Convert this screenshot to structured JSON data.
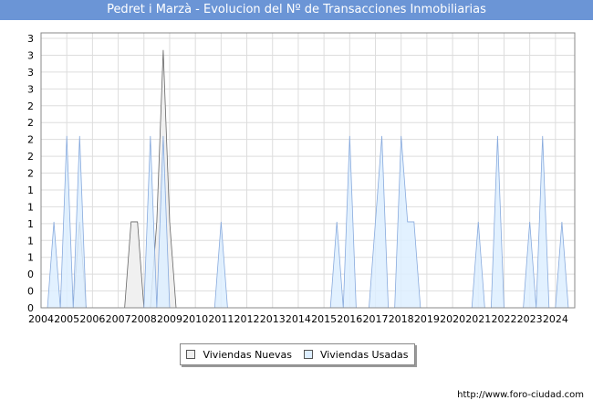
{
  "title": "Pedret i Marzà - Evolucion del Nº de Transacciones Inmobiliarias",
  "source": "http://www.foro-ciudad.com",
  "chart_data": {
    "type": "area",
    "x_ticks": [
      "2004",
      "2005",
      "2006",
      "2007",
      "2008",
      "2009",
      "2010",
      "2011",
      "2012",
      "2013",
      "2014",
      "2015",
      "2016",
      "2017",
      "2018",
      "2019",
      "2020",
      "2021",
      "2022",
      "2023",
      "2024"
    ],
    "y_tick_labels": [
      "0",
      "0",
      "0",
      "1",
      "1",
      "1",
      "1",
      "1",
      "2",
      "2",
      "2",
      "2",
      "2",
      "3",
      "3",
      "3",
      "3"
    ],
    "ylim": [
      0,
      3.2
    ],
    "xlim": [
      2004,
      2024.75
    ],
    "legend_position": "bottom-center",
    "grid": true,
    "series": [
      {
        "name": "Viviendas Nuevas",
        "color": "#f0f0f0",
        "stroke": "#666666",
        "points": [
          [
            2005.25,
            0
          ],
          [
            2005.5,
            1
          ],
          [
            2005.75,
            0
          ],
          [
            2007.25,
            0
          ],
          [
            2007.5,
            1
          ],
          [
            2007.75,
            1
          ],
          [
            2008,
            0
          ],
          [
            2008.25,
            0
          ],
          [
            2008.5,
            1
          ],
          [
            2008.75,
            3
          ],
          [
            2009,
            1
          ],
          [
            2009.25,
            0
          ]
        ]
      },
      {
        "name": "Viviendas Usadas",
        "color": "#ddeeff",
        "stroke": "#88aadd",
        "points": [
          [
            2004.25,
            0
          ],
          [
            2004.5,
            1
          ],
          [
            2004.75,
            0
          ],
          [
            2005,
            2
          ],
          [
            2005.25,
            0
          ],
          [
            2005.5,
            2
          ],
          [
            2005.75,
            0
          ],
          [
            2008,
            0
          ],
          [
            2008.25,
            2
          ],
          [
            2008.5,
            0
          ],
          [
            2008.75,
            2
          ],
          [
            2009,
            0
          ],
          [
            2009.25,
            0
          ],
          [
            2010.75,
            0
          ],
          [
            2011,
            1
          ],
          [
            2011.25,
            0
          ],
          [
            2015.25,
            0
          ],
          [
            2015.5,
            1
          ],
          [
            2015.75,
            0
          ],
          [
            2016,
            2
          ],
          [
            2016.25,
            0
          ],
          [
            2016.75,
            0
          ],
          [
            2017,
            1
          ],
          [
            2017.25,
            2
          ],
          [
            2017.5,
            0
          ],
          [
            2017.75,
            0
          ],
          [
            2018,
            2
          ],
          [
            2018.25,
            1
          ],
          [
            2018.5,
            1
          ],
          [
            2018.75,
            0
          ],
          [
            2020.75,
            0
          ],
          [
            2021,
            1
          ],
          [
            2021.25,
            0
          ],
          [
            2021.5,
            0
          ],
          [
            2021.75,
            2
          ],
          [
            2022,
            0
          ],
          [
            2022.75,
            0
          ],
          [
            2023,
            1
          ],
          [
            2023.25,
            0
          ],
          [
            2023.5,
            2
          ],
          [
            2023.75,
            0
          ],
          [
            2024,
            0
          ],
          [
            2024.25,
            1
          ],
          [
            2024.5,
            0
          ]
        ]
      }
    ]
  }
}
